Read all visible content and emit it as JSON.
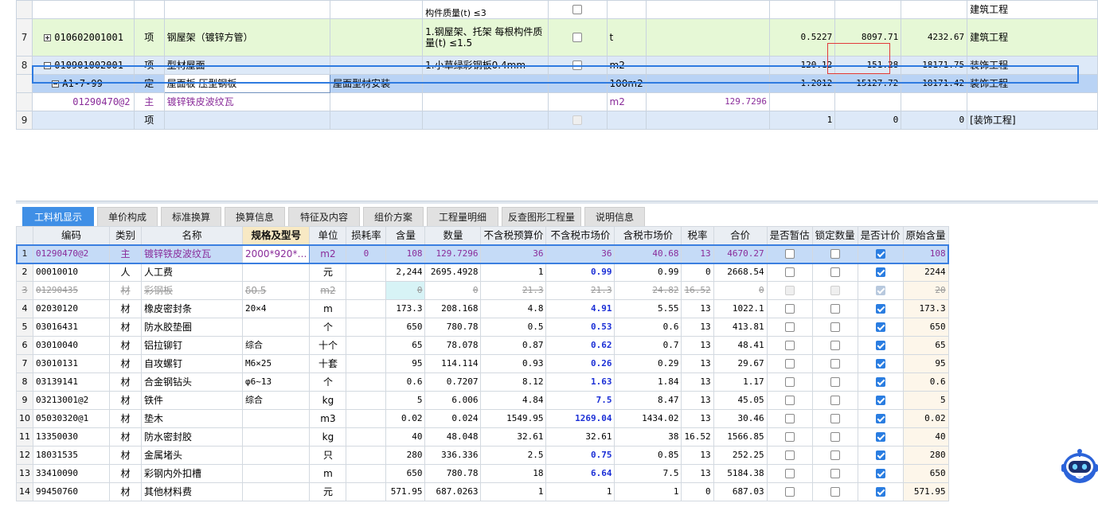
{
  "top_grid": {
    "rows": [
      {
        "index": "",
        "code": "",
        "type": "",
        "name": "",
        "spec": "",
        "feature": "构件质量(t) ≤3",
        "checked": false,
        "unit": "",
        "q1": "",
        "q2": "",
        "price": "",
        "total": "",
        "category": "建筑工程",
        "variant": "white-top"
      },
      {
        "index": "7",
        "code": "010602001001",
        "type": "项",
        "name": "钢屋架（镀锌方管）",
        "spec": "",
        "feature": "1.钢屋架、托架 每根构件质量(t) ≤1.5",
        "checked": false,
        "unit": "t",
        "q1": "",
        "q2": "0.5227",
        "price": "8097.71",
        "total": "4232.67",
        "category": "建筑工程",
        "variant": "green"
      },
      {
        "index": "8",
        "code": "010901002001",
        "type": "项",
        "name": "型材屋面",
        "spec": "",
        "feature": "1.小草绿彩钢板0.4mm",
        "checked": false,
        "unit": "m2",
        "q1": "",
        "q2": "120.12",
        "price": "151.28",
        "total": "18171.75",
        "category": "装饰工程",
        "variant": "blue"
      },
      {
        "index": "",
        "code": "A1-7-99",
        "type": "定",
        "name": "屋面板 压型钢板",
        "spec": "屋面型材安装",
        "feature": "",
        "checked": null,
        "unit": "100m2",
        "q1": "",
        "q2": "1.2012",
        "price": "15127.72",
        "total": "18171.42",
        "category": "装饰工程",
        "variant": "sel"
      },
      {
        "index": "",
        "code": "01290470@2",
        "type": "主",
        "name": "镀锌铁皮波纹瓦",
        "spec": "",
        "feature": "",
        "checked": null,
        "unit": "m2",
        "q1": "129.7296",
        "q2": "",
        "price": "",
        "total": "",
        "category": "",
        "variant": "white"
      },
      {
        "index": "9",
        "code": "",
        "type": "项",
        "name": "",
        "spec": "",
        "feature": "",
        "checked": false,
        "unit": "",
        "q1": "",
        "q2": "1",
        "price": "0",
        "total": "0",
        "category": "[装饰工程]",
        "variant": "blue"
      }
    ]
  },
  "tabs": [
    {
      "label": "工料机显示",
      "active": true
    },
    {
      "label": "单价构成",
      "active": false
    },
    {
      "label": "标准换算",
      "active": false
    },
    {
      "label": "换算信息",
      "active": false
    },
    {
      "label": "特征及内容",
      "active": false
    },
    {
      "label": "组价方案",
      "active": false
    },
    {
      "label": "工程量明细",
      "active": false
    },
    {
      "label": "反查图形工程量",
      "active": false
    },
    {
      "label": "说明信息",
      "active": false
    }
  ],
  "bottom_grid": {
    "headers": [
      "编码",
      "类别",
      "名称",
      "规格及型号",
      "单位",
      "损耗率",
      "含量",
      "数量",
      "不含税预算价",
      "不含税市场价",
      "含税市场价",
      "税率",
      "合价",
      "是否暂估",
      "锁定数量",
      "是否计价",
      "原始含量"
    ],
    "rows": [
      {
        "index": "1",
        "code": "01290470@2",
        "cat": "主",
        "name": "镀锌铁皮波纹瓦",
        "spec": "2000*920*…",
        "unit": "m2",
        "loss": "0",
        "content": "108",
        "qty": "129.7296",
        "budget": "36",
        "market": "36",
        "market_tax": "40.68",
        "tax": "13",
        "total": "4670.27",
        "est": false,
        "lock": false,
        "priced": true,
        "orig": "108",
        "state": "sel"
      },
      {
        "index": "2",
        "code": "00010010",
        "cat": "人",
        "name": "人工费",
        "spec": "",
        "unit": "元",
        "loss": "",
        "content": "2,244",
        "qty": "2695.4928",
        "budget": "1",
        "market": "0.99",
        "market_tax": "0.99",
        "tax": "0",
        "total": "2668.54",
        "est": false,
        "lock": false,
        "priced": true,
        "orig": "2244",
        "state": "normal"
      },
      {
        "index": "3",
        "code": "01290435",
        "cat": "材",
        "name": "彩钢板",
        "spec": "δ0.5",
        "unit": "m2",
        "loss": "",
        "content": "0",
        "qty": "0",
        "budget": "21.3",
        "market": "21.3",
        "market_tax": "24.82",
        "tax": "16.52",
        "total": "0",
        "est": false,
        "lock": false,
        "priced": true,
        "orig": "20",
        "state": "strike"
      },
      {
        "index": "4",
        "code": "02030120",
        "cat": "材",
        "name": "橡皮密封条",
        "spec": "20×4",
        "unit": "m",
        "loss": "",
        "content": "173.3",
        "qty": "208.168",
        "budget": "4.8",
        "market": "4.91",
        "market_tax": "5.55",
        "tax": "13",
        "total": "1022.1",
        "est": false,
        "lock": false,
        "priced": true,
        "orig": "173.3",
        "state": "normal"
      },
      {
        "index": "5",
        "code": "03016431",
        "cat": "材",
        "name": "防水胶垫圈",
        "spec": "",
        "unit": "个",
        "loss": "",
        "content": "650",
        "qty": "780.78",
        "budget": "0.5",
        "market": "0.53",
        "market_tax": "0.6",
        "tax": "13",
        "total": "413.81",
        "est": false,
        "lock": false,
        "priced": true,
        "orig": "650",
        "state": "normal"
      },
      {
        "index": "6",
        "code": "03010040",
        "cat": "材",
        "name": "铝拉铆钉",
        "spec": "综合",
        "unit": "十个",
        "loss": "",
        "content": "65",
        "qty": "78.078",
        "budget": "0.87",
        "market": "0.62",
        "market_tax": "0.7",
        "tax": "13",
        "total": "48.41",
        "est": false,
        "lock": false,
        "priced": true,
        "orig": "65",
        "state": "normal"
      },
      {
        "index": "7",
        "code": "03010131",
        "cat": "材",
        "name": "自攻螺钉",
        "spec": "M6×25",
        "unit": "十套",
        "loss": "",
        "content": "95",
        "qty": "114.114",
        "budget": "0.93",
        "market": "0.26",
        "market_tax": "0.29",
        "tax": "13",
        "total": "29.67",
        "est": false,
        "lock": false,
        "priced": true,
        "orig": "95",
        "state": "normal"
      },
      {
        "index": "8",
        "code": "03139141",
        "cat": "材",
        "name": "合金钢钻头",
        "spec": "φ6~13",
        "unit": "个",
        "loss": "",
        "content": "0.6",
        "qty": "0.7207",
        "budget": "8.12",
        "market": "1.63",
        "market_tax": "1.84",
        "tax": "13",
        "total": "1.17",
        "est": false,
        "lock": false,
        "priced": true,
        "orig": "0.6",
        "state": "normal"
      },
      {
        "index": "9",
        "code": "03213001@2",
        "cat": "材",
        "name": "铁件",
        "spec": "综合",
        "unit": "kg",
        "loss": "",
        "content": "5",
        "qty": "6.006",
        "budget": "4.84",
        "market": "7.5",
        "market_tax": "8.47",
        "tax": "13",
        "total": "45.05",
        "est": false,
        "lock": false,
        "priced": true,
        "orig": "5",
        "state": "normal"
      },
      {
        "index": "10",
        "code": "05030320@1",
        "cat": "材",
        "name": "垫木",
        "spec": "",
        "unit": "m3",
        "loss": "",
        "content": "0.02",
        "qty": "0.024",
        "budget": "1549.95",
        "market": "1269.04",
        "market_tax": "1434.02",
        "tax": "13",
        "total": "30.46",
        "est": false,
        "lock": false,
        "priced": true,
        "orig": "0.02",
        "state": "normal"
      },
      {
        "index": "11",
        "code": "13350030",
        "cat": "材",
        "name": "防水密封胶",
        "spec": "",
        "unit": "kg",
        "loss": "",
        "content": "40",
        "qty": "48.048",
        "budget": "32.61",
        "market": "32.61",
        "market_tax": "38",
        "tax": "16.52",
        "total": "1566.85",
        "est": false,
        "lock": false,
        "priced": true,
        "orig": "40",
        "state": "normal",
        "market_plain": true
      },
      {
        "index": "12",
        "code": "18031535",
        "cat": "材",
        "name": "金属堵头",
        "spec": "",
        "unit": "只",
        "loss": "",
        "content": "280",
        "qty": "336.336",
        "budget": "2.5",
        "market": "0.75",
        "market_tax": "0.85",
        "tax": "13",
        "total": "252.25",
        "est": false,
        "lock": false,
        "priced": true,
        "orig": "280",
        "state": "normal"
      },
      {
        "index": "13",
        "code": "33410090",
        "cat": "材",
        "name": "彩钢内外扣槽",
        "spec": "",
        "unit": "m",
        "loss": "",
        "content": "650",
        "qty": "780.78",
        "budget": "18",
        "market": "6.64",
        "market_tax": "7.5",
        "tax": "13",
        "total": "5184.38",
        "est": false,
        "lock": false,
        "priced": true,
        "orig": "650",
        "state": "normal"
      },
      {
        "index": "14",
        "code": "99450760",
        "cat": "材",
        "name": "其他材料费",
        "spec": "",
        "unit": "元",
        "loss": "",
        "content": "571.95",
        "qty": "687.0263",
        "budget": "1",
        "market": "1",
        "market_tax": "1",
        "tax": "0",
        "total": "687.03",
        "est": false,
        "lock": false,
        "priced": true,
        "orig": "571.95",
        "state": "normal",
        "market_plain": true
      }
    ]
  },
  "colors": {
    "accent": "#3f8fe6",
    "row_green": "#e6f8d6",
    "row_blue": "#dde9f8",
    "row_selected": "#b9d3f5",
    "highlight_box": "#e23a3a",
    "market_price_text": "#1b2fd6",
    "material_code_text": "#8a2c9a"
  }
}
